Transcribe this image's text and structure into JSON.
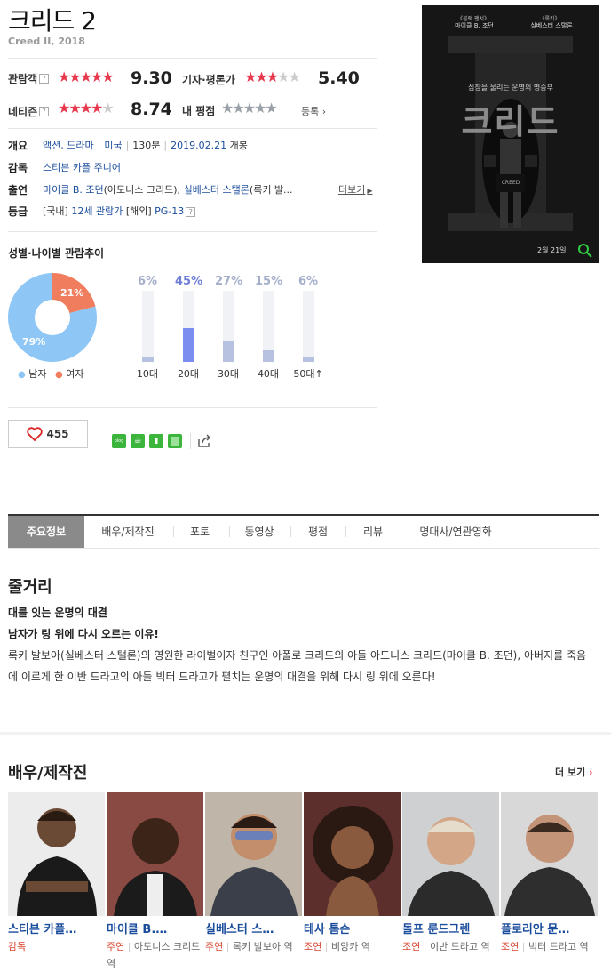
{
  "movie": {
    "title": "크리드 2",
    "subtitle": "Creed II, 2018"
  },
  "ratings": {
    "audience_label": "관람객",
    "audience_score": "9.30",
    "critic_label": "기자·평론가",
    "critic_score": "5.40",
    "netizen_label": "네티즌",
    "netizen_score": "8.74",
    "my_label": "내 평점",
    "register_label": "등록",
    "help_glyph": "?"
  },
  "info": {
    "overview_label": "개요",
    "genre": "액션, 드라마",
    "country": "미국",
    "runtime": "130분",
    "release_date": "2019.02.21",
    "release_suffix": "개봉",
    "director_label": "감독",
    "director": "스티븐 카플 주니어",
    "cast_label": "출연",
    "cast_text_1": "마이클 B. 조던",
    "cast_text_2": "(아도니스 크리드),",
    "cast_text_3": "실베스터 스탤론",
    "cast_text_4": "(록키 발...",
    "more_label": "더보기",
    "grade_label": "등급",
    "grade_domestic": "[국내]",
    "grade_domestic_value": "12세 관람가",
    "grade_foreign": "[해외]",
    "grade_foreign_value": "PG-13"
  },
  "poster": {
    "top_left_1": "《블랙 팬서》",
    "top_left_2": "마이클 B. 조던",
    "top_right_1": "《록키》",
    "top_right_2": "실베스터 스탤론",
    "tagline": "심장을 울리는 운명의 명승부",
    "title": "크리드",
    "shorts_text": "CREED",
    "date": "2월 21일"
  },
  "demographics": {
    "title": "성별·나이별 관람추이",
    "male_pct": 79,
    "female_pct": 21,
    "male_label_value": "79%",
    "female_label_value": "21%",
    "male_legend": "남자",
    "female_legend": "여자",
    "male_color": "#8ec6f5",
    "female_color": "#f07e5e",
    "ages": [
      {
        "label": "10대",
        "pct": 6,
        "pct_text": "6%"
      },
      {
        "label": "20대",
        "pct": 45,
        "pct_text": "45%"
      },
      {
        "label": "30대",
        "pct": 27,
        "pct_text": "27%"
      },
      {
        "label": "40대",
        "pct": 15,
        "pct_text": "15%"
      },
      {
        "label": "50대↑",
        "pct": 6,
        "pct_text": "6%"
      }
    ]
  },
  "like": {
    "count": "455"
  },
  "share": {
    "blog_label": "blog"
  },
  "tabs": [
    "주요정보",
    "배우/제작진",
    "포토",
    "동영상",
    "평점",
    "리뷰",
    "명대사/연관영화"
  ],
  "story": {
    "heading": "줄거리",
    "line1": "대를 잇는 운명의 대결",
    "line2": "남자가 링 위에 다시 오르는 이유!",
    "body": "록키 발보아(실베스터 스탤론)의 영원한 라이벌이자 친구인 아폴로 크리드의 아들 아도니스 크리드(마이클 B. 조던), 아버지를 죽음에 이르게 한 이반 드라고의 아들 빅터 드라고가 펼치는 운명의 대결을 위해 다시 링 위에 오른다!"
  },
  "crew": {
    "heading": "배우/제작진",
    "more": "더 보기",
    "people": [
      {
        "name": "스티븐 카플…",
        "role_type": "감독",
        "role": ""
      },
      {
        "name": "마이클 B.…",
        "role_type": "주연",
        "role": "아도니스 크리드 역"
      },
      {
        "name": "실베스터 스…",
        "role_type": "주연",
        "role": "록키 발보아 역"
      },
      {
        "name": "테사 톰슨",
        "role_type": "조연",
        "role": "비앙카 역"
      },
      {
        "name": "돌프 룬드그렌",
        "role_type": "조연",
        "role": "이반 드라고 역"
      },
      {
        "name": "플로리안 문…",
        "role_type": "조연",
        "role": "빅터 드라고 역"
      }
    ]
  }
}
